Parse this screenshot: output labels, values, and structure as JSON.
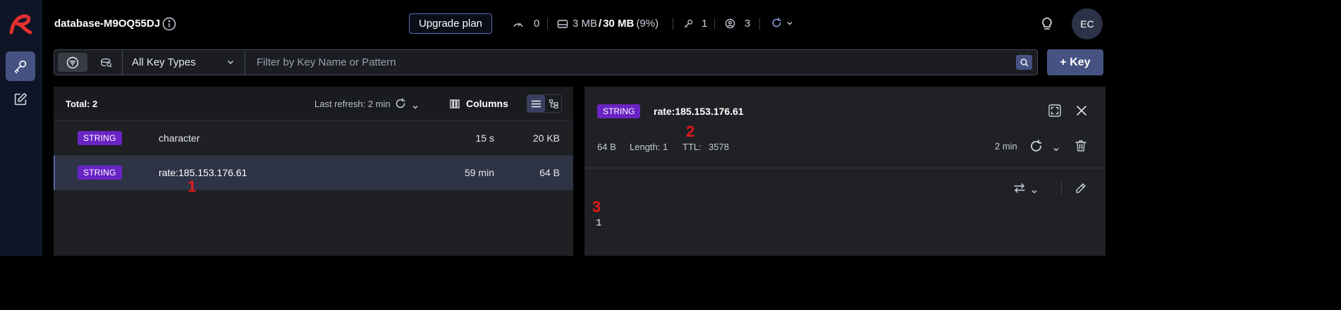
{
  "rail": {
    "items": [
      {
        "name": "browser",
        "active": true
      },
      {
        "name": "workbench",
        "active": false
      }
    ]
  },
  "header": {
    "database_name": "database-M9OQ55DJ",
    "upgrade_label": "Upgrade plan",
    "stats": {
      "ops": "0",
      "memory_used": "3 MB",
      "memory_slash": "/",
      "memory_total": "30 MB",
      "memory_pct": "(9%)",
      "keys": "1",
      "clients": "3"
    },
    "avatar_initials": "EC"
  },
  "filter": {
    "key_type": "All Key Types",
    "search_placeholder": "Filter by Key Name or Pattern",
    "search_value": "",
    "add_key_label": "+ Key"
  },
  "list": {
    "total_label": "Total: 2",
    "last_refresh": "Last refresh: 2 min",
    "columns_label": "Columns",
    "rows": [
      {
        "type": "STRING",
        "name": "character",
        "ttl": "15 s",
        "size": "20 KB",
        "selected": false
      },
      {
        "type": "STRING",
        "name": "rate:185.153.176.61",
        "ttl": "59 min",
        "size": "64 B",
        "selected": true
      }
    ]
  },
  "detail": {
    "type": "STRING",
    "key": "rate:185.153.176.61",
    "size": "64 B",
    "length": "Length: 1",
    "ttl_label": "TTL:",
    "ttl_value": "3578",
    "last_refresh": "2 min",
    "value": "1"
  },
  "annotations": {
    "a1": "1",
    "a2": "2",
    "a3": "3"
  },
  "colors": {
    "accent": "#465282",
    "badge_string": "#6a24c4",
    "annotation": "#e5191b",
    "logo": "#e5302e"
  }
}
